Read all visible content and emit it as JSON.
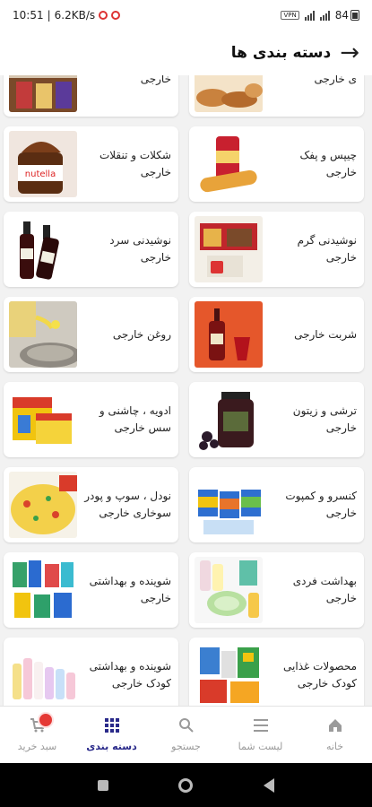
{
  "status_bar": {
    "time": "10:51",
    "network_speed": "6.2KB/s",
    "battery": "84"
  },
  "header": {
    "title": "دسته بندی ها",
    "back_icon": "arrow-right-icon"
  },
  "categories": [
    {
      "left": {
        "label": "خارجی",
        "icon": "snacks-package-image"
      },
      "right": {
        "label": "ی خارجی",
        "icon": "bakery-image"
      }
    },
    {
      "left": {
        "label": "شکلات و تنقلات خارجی",
        "icon": "chocolate-spread-image"
      },
      "right": {
        "label": "چیپس و پفک خارجی",
        "icon": "chips-can-image"
      }
    },
    {
      "left": {
        "label": "نوشیدنی سرد خارجی",
        "icon": "cold-drink-bottles-image"
      },
      "right": {
        "label": "نوشیدنی گرم خارجی",
        "icon": "coffee-box-image"
      }
    },
    {
      "left": {
        "label": "روغن خارجی",
        "icon": "oil-pour-image"
      },
      "right": {
        "label": "شربت خارجی",
        "icon": "syrup-bottle-image"
      }
    },
    {
      "left": {
        "label": "ادویه ، چاشنی و سس خارجی",
        "icon": "spice-boxes-image"
      },
      "right": {
        "label": "ترشی و زیتون خارجی",
        "icon": "olive-jar-image"
      }
    },
    {
      "left": {
        "label": "نودل ، سوپ و پودر سوخاری خارجی",
        "icon": "noodle-dish-image"
      },
      "right": {
        "label": "کنسرو و کمپوت خارجی",
        "icon": "canned-food-image"
      }
    },
    {
      "left": {
        "label": "شوینده و بهداشتی خارجی",
        "icon": "detergents-image"
      },
      "right": {
        "label": "بهداشت فردی خارجی",
        "icon": "personal-care-image"
      }
    },
    {
      "left": {
        "label": "شوینده و بهداشتی کودک خارجی",
        "icon": "baby-care-image"
      },
      "right": {
        "label": "محصولات غذایی کودک خارجی",
        "icon": "baby-food-image"
      }
    }
  ],
  "bottom_nav": [
    {
      "label": "سبد خرید",
      "icon": "cart-icon"
    },
    {
      "label": "دسته بندی",
      "icon": "grid-icon",
      "active": true
    },
    {
      "label": "جستجو",
      "icon": "search-icon"
    },
    {
      "label": "لیست شما",
      "icon": "list-icon"
    },
    {
      "label": "خانه",
      "icon": "home-icon"
    }
  ],
  "colors": {
    "active_nav": "#2a2a8a",
    "inactive_nav": "#9a9a9a",
    "cart_badge": "#e53935",
    "background": "#f2f2f2"
  }
}
